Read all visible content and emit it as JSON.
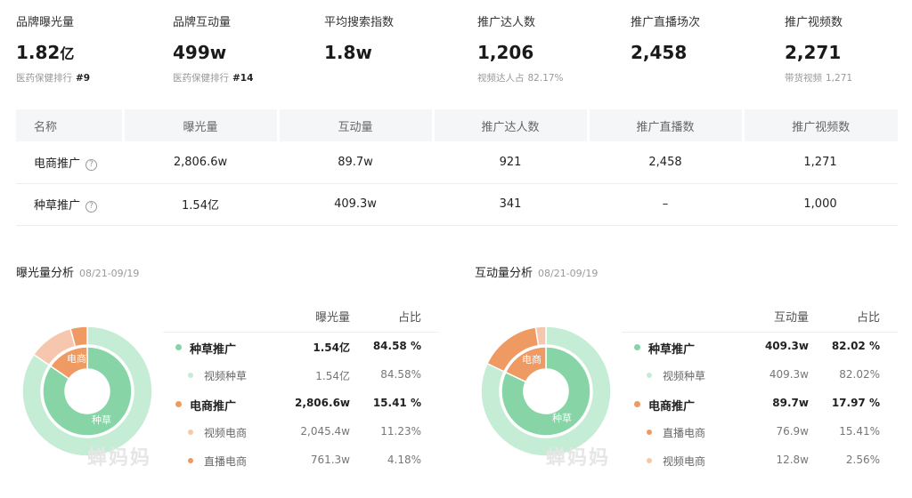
{
  "metrics": [
    {
      "label": "品牌曝光量",
      "value": "1.82",
      "unit": "亿",
      "sub_label": "医药保健排行",
      "sub_value": "#9"
    },
    {
      "label": "品牌互动量",
      "value": "499w",
      "unit": "",
      "sub_label": "医药保健排行",
      "sub_value": "#14"
    },
    {
      "label": "平均搜索指数",
      "value": "1.8w",
      "unit": "",
      "sub_label": "",
      "sub_value": ""
    },
    {
      "label": "推广达人数",
      "value": "1,206",
      "unit": "",
      "sub_label": "视频达人占",
      "sub_value": "82.17%"
    },
    {
      "label": "推广直播场次",
      "value": "2,458",
      "unit": "",
      "sub_label": "",
      "sub_value": ""
    },
    {
      "label": "推广视频数",
      "value": "2,271",
      "unit": "",
      "sub_label": "带货视频",
      "sub_value": "1,271"
    }
  ],
  "summary": {
    "headers": [
      "名称",
      "曝光量",
      "互动量",
      "推广达人数",
      "推广直播数",
      "推广视频数"
    ],
    "rows": [
      {
        "name": "电商推广",
        "cells": [
          "2,806.6w",
          "89.7w",
          "921",
          "2,458",
          "1,271"
        ]
      },
      {
        "name": "种草推广",
        "cells": [
          "1.54亿",
          "409.3w",
          "341",
          "–",
          "1,000"
        ]
      }
    ]
  },
  "colors": {
    "green": "#87d4a6",
    "green_light": "#c5ecd5",
    "orange": "#ef9a63",
    "orange_light": "#f6c7ae",
    "orange_lighter": "#f9dccd"
  },
  "panels": [
    {
      "title": "曝光量分析",
      "date": "08/21-09/19",
      "col_value": "曝光量",
      "col_share": "占比",
      "inner_label_top": "电商",
      "inner_label_bottom": "种草",
      "rows": [
        {
          "type": "main",
          "name": "种草推广",
          "value": "1.54亿",
          "share": "84.58 %",
          "color": "#87d4a6"
        },
        {
          "type": "child",
          "name": "视频种草",
          "value": "1.54亿",
          "share": "84.58%",
          "color": "#c5ecd5"
        },
        {
          "type": "main",
          "name": "电商推广",
          "value": "2,806.6w",
          "share": "15.41 %",
          "color": "#ef9a63"
        },
        {
          "type": "child",
          "name": "视频电商",
          "value": "2,045.4w",
          "share": "11.23%",
          "color": "#f6c7ae"
        },
        {
          "type": "child",
          "name": "直播电商",
          "value": "761.3w",
          "share": "4.18%",
          "color": "#ef9a63"
        }
      ],
      "inner_ring": [
        {
          "name": "种草推广",
          "value": 84.58,
          "color": "#87d4a6"
        },
        {
          "name": "电商推广",
          "value": 15.41,
          "color": "#ef9a63"
        }
      ],
      "outer_ring": [
        {
          "name": "视频种草",
          "value": 84.58,
          "color": "#c5ecd5"
        },
        {
          "name": "视频电商",
          "value": 11.23,
          "color": "#f6c7ae"
        },
        {
          "name": "直播电商",
          "value": 4.18,
          "color": "#ef9a63"
        }
      ]
    },
    {
      "title": "互动量分析",
      "date": "08/21-09/19",
      "col_value": "互动量",
      "col_share": "占比",
      "inner_label_top": "电商",
      "inner_label_bottom": "种草",
      "rows": [
        {
          "type": "main",
          "name": "种草推广",
          "value": "409.3w",
          "share": "82.02 %",
          "color": "#87d4a6"
        },
        {
          "type": "child",
          "name": "视频种草",
          "value": "409.3w",
          "share": "82.02%",
          "color": "#c5ecd5"
        },
        {
          "type": "main",
          "name": "电商推广",
          "value": "89.7w",
          "share": "17.97 %",
          "color": "#ef9a63"
        },
        {
          "type": "child",
          "name": "直播电商",
          "value": "76.9w",
          "share": "15.41%",
          "color": "#ef9a63"
        },
        {
          "type": "child",
          "name": "视频电商",
          "value": "12.8w",
          "share": "2.56%",
          "color": "#f6c7ae"
        }
      ],
      "inner_ring": [
        {
          "name": "种草推广",
          "value": 82.02,
          "color": "#87d4a6"
        },
        {
          "name": "电商推广",
          "value": 17.97,
          "color": "#ef9a63"
        }
      ],
      "outer_ring": [
        {
          "name": "视频种草",
          "value": 82.02,
          "color": "#c5ecd5"
        },
        {
          "name": "直播电商",
          "value": 15.41,
          "color": "#ef9a63"
        },
        {
          "name": "视频电商",
          "value": 2.56,
          "color": "#f6c7ae"
        }
      ]
    }
  ],
  "watermark": "蝉妈妈"
}
